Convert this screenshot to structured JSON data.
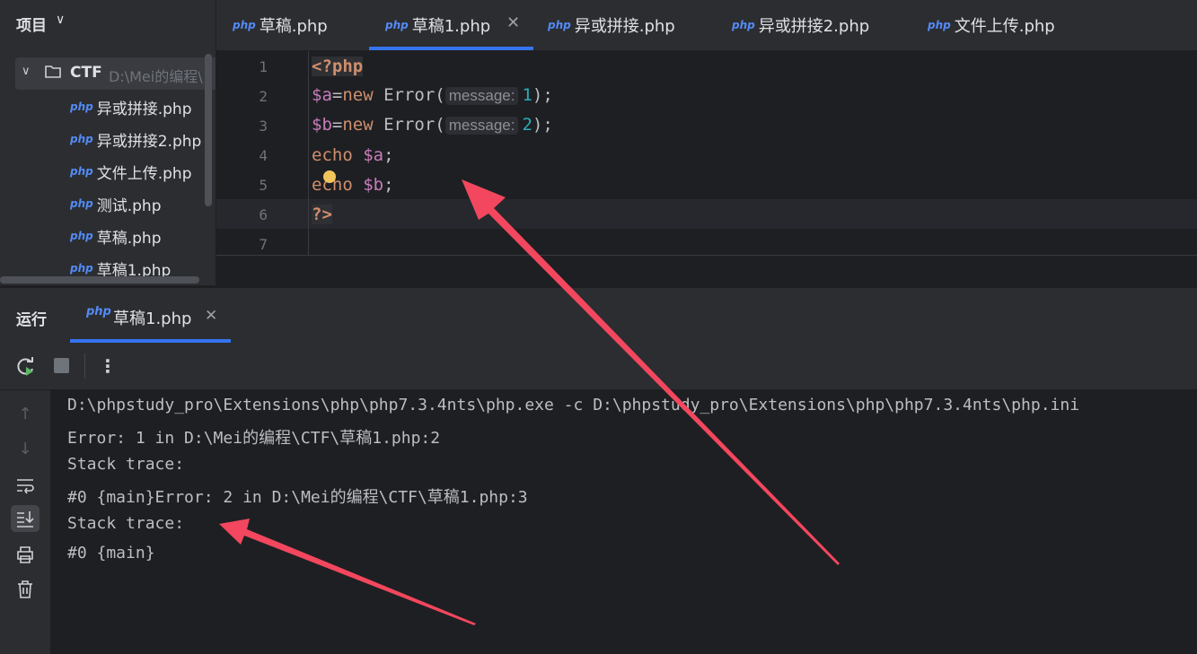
{
  "project": {
    "header": "项目",
    "root": {
      "name": "CTF",
      "path": "D:\\Mei的编程\\"
    },
    "files": [
      {
        "icon": "php",
        "name": "异或拼接.php"
      },
      {
        "icon": "php",
        "name": "异或拼接2.php"
      },
      {
        "icon": "php",
        "name": "文件上传.php"
      },
      {
        "icon": "php",
        "name": "测试.php"
      },
      {
        "icon": "php",
        "name": "草稿.php"
      },
      {
        "icon": "php",
        "name": "草稿1.php"
      }
    ]
  },
  "tabs": [
    {
      "icon": "php",
      "label": "草稿.php"
    },
    {
      "icon": "php",
      "label": "草稿1.php",
      "active": true
    },
    {
      "icon": "php",
      "label": "异或拼接.php"
    },
    {
      "icon": "php",
      "label": "异或拼接2.php"
    },
    {
      "icon": "php",
      "label": "文件上传.php"
    }
  ],
  "editor": {
    "line_numbers": [
      "1",
      "2",
      "3",
      "4",
      "5",
      "6",
      "7"
    ],
    "lines": {
      "l1": {
        "tag": "<?php"
      },
      "l2": {
        "var": "$a",
        "eq": "=",
        "kw": "new",
        "cls": " Error(",
        "hint": "message:",
        "num": "1",
        "end": ");"
      },
      "l3": {
        "var": "$b",
        "eq": "=",
        "kw": "new",
        "cls": " Error(",
        "hint": "message:",
        "num": "2",
        "end": ");"
      },
      "l4": {
        "kw": "echo",
        "sp": " ",
        "var": "$a",
        "end": ";"
      },
      "l5": {
        "kw": "echo",
        "sp": " ",
        "var": "$b",
        "end": ";"
      },
      "l6": {
        "tag": "?>"
      }
    }
  },
  "run": {
    "title": "运行",
    "tab_icon": "php",
    "tab_label": "草稿1.php",
    "output": [
      "D:\\phpstudy_pro\\Extensions\\php\\php7.3.4nts\\php.exe -c D:\\phpstudy_pro\\Extensions\\php\\php7.3.4nts\\php.ini",
      "Error: 1 in D:\\Mei的编程\\CTF\\草稿1.php:2",
      "Stack trace:",
      "#0 {main}Error: 2 in D:\\Mei的编程\\CTF\\草稿1.php:3",
      "Stack trace:",
      "#0 {main}"
    ]
  },
  "colors": {
    "accent": "#3574f0",
    "annotation_arrow": "#f2475e"
  }
}
